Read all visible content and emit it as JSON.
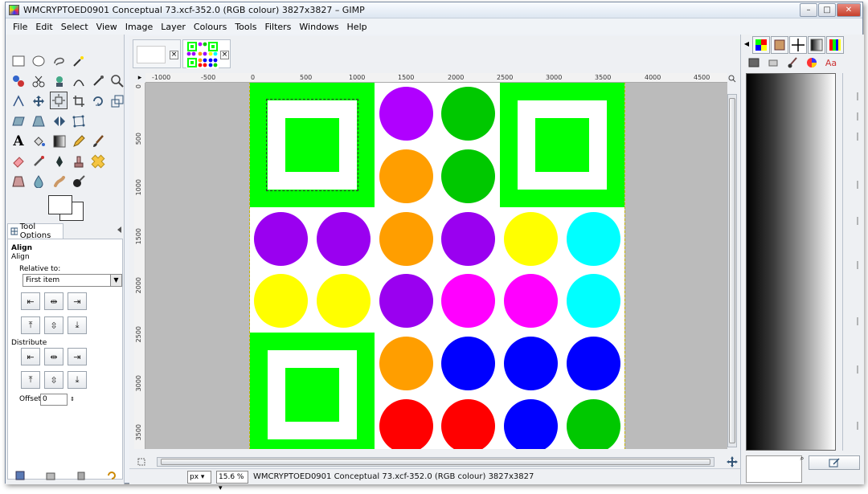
{
  "window": {
    "title": "WMCRYPTOED0901 Conceptual 73.xcf-352.0 (RGB colour) 3827x3827 – GIMP",
    "min_label": "–",
    "max_label": "□",
    "close_label": "✕"
  },
  "menu": {
    "items": [
      "File",
      "Edit",
      "Select",
      "View",
      "Image",
      "Layer",
      "Colours",
      "Tools",
      "Filters",
      "Windows",
      "Help"
    ]
  },
  "toolbox": {
    "tool_options_tab": "Tool Options",
    "options": {
      "tool_name": "Align",
      "section_title": "Align",
      "relative_to_label": "Relative to:",
      "relative_to_value": "First item",
      "distribute_label": "Distribute",
      "offset_label": "Offset:",
      "offset_value": "0"
    }
  },
  "ruler": {
    "top_labels": [
      "-1000",
      "-500",
      "0",
      "500",
      "1000",
      "1500",
      "2000",
      "2500",
      "3000",
      "3500",
      "4000",
      "4500"
    ],
    "left_labels": [
      "0",
      "500",
      "1000",
      "1500",
      "2000",
      "2500",
      "3000",
      "3500"
    ]
  },
  "status": {
    "unit": "px",
    "zoom": "15.6 %",
    "text": "WMCRYPTOED0901 Conceptual 73.xcf-352.0 (RGB colour) 3827x3827"
  },
  "colors": {
    "green": "#00ff00",
    "dark_green": "#00c800",
    "purple": "#b000ff",
    "violet": "#9a00f0",
    "orange": "#ff9e00",
    "yellow": "#ffff00",
    "cyan": "#00ffff",
    "magenta": "#ff00ff",
    "blue": "#0000ff",
    "red": "#ff0000"
  },
  "canvas_art": {
    "circles": [
      {
        "col": 2,
        "row": 0,
        "color": "#b000ff"
      },
      {
        "col": 3,
        "row": 0,
        "color": "#00c800"
      },
      {
        "col": 2,
        "row": 1,
        "color": "#ff9e00"
      },
      {
        "col": 3,
        "row": 1,
        "color": "#00c800"
      },
      {
        "col": 0,
        "row": 2,
        "color": "#9a00f0"
      },
      {
        "col": 1,
        "row": 2,
        "color": "#9a00f0"
      },
      {
        "col": 2,
        "row": 2,
        "color": "#ff9e00"
      },
      {
        "col": 3,
        "row": 2,
        "color": "#9a00f0"
      },
      {
        "col": 4,
        "row": 2,
        "color": "#ffff00"
      },
      {
        "col": 5,
        "row": 2,
        "color": "#00ffff"
      },
      {
        "col": 0,
        "row": 3,
        "color": "#ffff00"
      },
      {
        "col": 1,
        "row": 3,
        "color": "#ffff00"
      },
      {
        "col": 2,
        "row": 3,
        "color": "#9a00f0"
      },
      {
        "col": 3,
        "row": 3,
        "color": "#ff00ff"
      },
      {
        "col": 4,
        "row": 3,
        "color": "#ff00ff"
      },
      {
        "col": 5,
        "row": 3,
        "color": "#00ffff"
      },
      {
        "col": 2,
        "row": 4,
        "color": "#ff9e00"
      },
      {
        "col": 3,
        "row": 4,
        "color": "#0000ff"
      },
      {
        "col": 4,
        "row": 4,
        "color": "#0000ff"
      },
      {
        "col": 5,
        "row": 4,
        "color": "#0000ff"
      },
      {
        "col": 2,
        "row": 5,
        "color": "#ff0000"
      },
      {
        "col": 3,
        "row": 5,
        "color": "#ff0000"
      },
      {
        "col": 4,
        "row": 5,
        "color": "#0000ff"
      },
      {
        "col": 5,
        "row": 5,
        "color": "#00c800"
      }
    ]
  }
}
